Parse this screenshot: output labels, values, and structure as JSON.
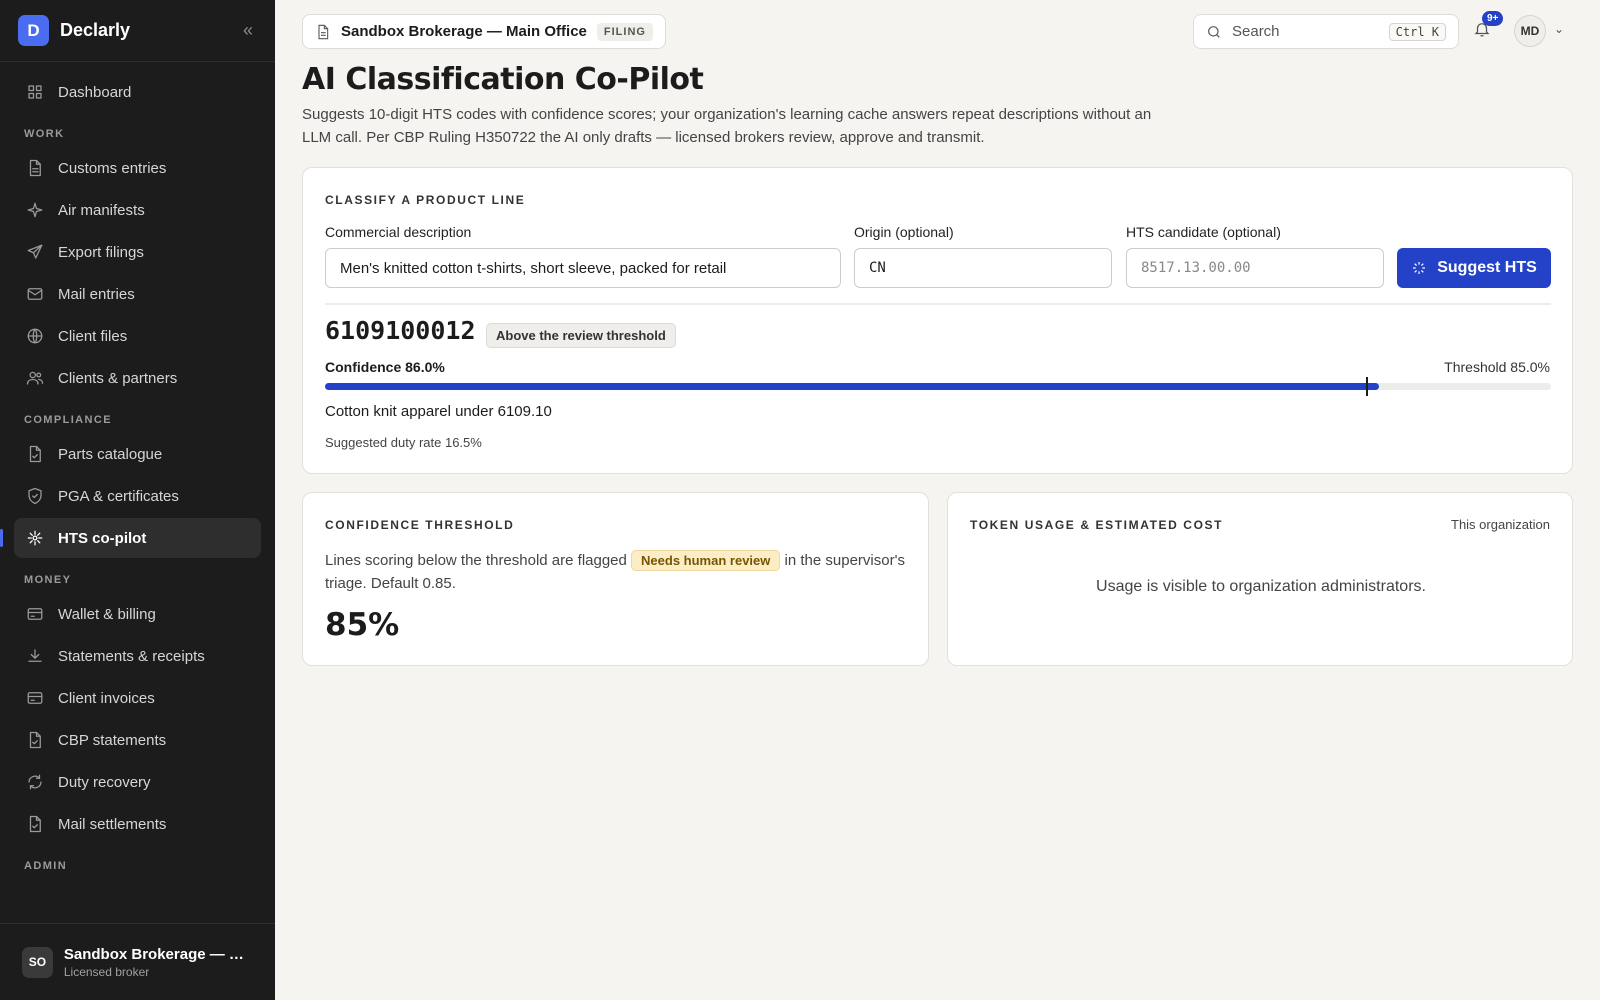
{
  "brand": {
    "logo_letter": "D",
    "name": "Declarly",
    "collapse_icon": "chevrons-left-icon"
  },
  "sidebar": {
    "top": [
      {
        "label": "Dashboard",
        "icon": "grid-icon"
      }
    ],
    "sections": [
      {
        "title": "WORK",
        "items": [
          {
            "label": "Customs entries",
            "icon": "document-icon"
          },
          {
            "label": "Air manifests",
            "icon": "sparkle-icon"
          },
          {
            "label": "Export filings",
            "icon": "send-icon"
          },
          {
            "label": "Mail entries",
            "icon": "mail-icon"
          },
          {
            "label": "Client files",
            "icon": "globe-icon"
          },
          {
            "label": "Clients & partners",
            "icon": "users-icon"
          }
        ]
      },
      {
        "title": "COMPLIANCE",
        "items": [
          {
            "label": "Parts catalogue",
            "icon": "file-check-icon"
          },
          {
            "label": "PGA & certificates",
            "icon": "shield-icon"
          },
          {
            "label": "HTS co-pilot",
            "icon": "sun-icon",
            "active": true
          }
        ]
      },
      {
        "title": "MONEY",
        "items": [
          {
            "label": "Wallet & billing",
            "icon": "card-icon"
          },
          {
            "label": "Statements & receipts",
            "icon": "download-icon"
          },
          {
            "label": "Client invoices",
            "icon": "card-icon"
          },
          {
            "label": "CBP statements",
            "icon": "file-check-icon"
          },
          {
            "label": "Duty recovery",
            "icon": "refresh-icon"
          },
          {
            "label": "Mail settlements",
            "icon": "file-check-icon"
          }
        ]
      },
      {
        "title": "ADMIN",
        "items": []
      }
    ],
    "footer": {
      "initials": "SO",
      "name": "Sandbox Brokerage — Main Office",
      "role": "Licensed broker"
    }
  },
  "topbar": {
    "org_name": "Sandbox Brokerage — Main Office",
    "org_badge": "FILING",
    "search_placeholder": "Search",
    "search_shortcut": "Ctrl K",
    "notification_count": "9+",
    "user_initials": "MD"
  },
  "header": {
    "title": "AI Classification Co-Pilot",
    "subtitle": "Suggests 10-digit HTS codes with confidence scores; your organization's learning cache answers repeat descriptions without an LLM call. Per CBP Ruling H350722 the AI only drafts — licensed brokers review, approve and transmit."
  },
  "classify": {
    "section_label": "CLASSIFY A PRODUCT LINE",
    "description_label": "Commercial description",
    "description_value": "Men's knitted cotton t-shirts, short sleeve, packed for retail",
    "origin_label": "Origin (optional)",
    "origin_value": "CN",
    "candidate_label": "HTS candidate (optional)",
    "candidate_placeholder": "8517.13.00.00",
    "submit_label": "Suggest HTS"
  },
  "result": {
    "hts_code": "6109100012",
    "status_pill": "Above the review threshold",
    "confidence_text": "Confidence 86.0%",
    "threshold_text": "Threshold 85.0%",
    "confidence": 0.86,
    "threshold": 0.85,
    "description": "Cotton knit apparel under 6109.10",
    "duty_rate": "Suggested duty rate 16.5%"
  },
  "threshold_card": {
    "section_label": "CONFIDENCE THRESHOLD",
    "text_before": "Lines scoring below the threshold are flagged",
    "flag_label": "Needs human review",
    "text_after": "in the supervisor's triage. Default 0.85.",
    "value": "85%"
  },
  "usage_card": {
    "section_label": "TOKEN USAGE & ESTIMATED COST",
    "scope": "This organization",
    "message": "Usage is visible to organization administrators."
  },
  "colors": {
    "accent": "#2442c8",
    "sidebar_bg": "#1c1c1c",
    "flag_bg": "#fbeec6"
  }
}
